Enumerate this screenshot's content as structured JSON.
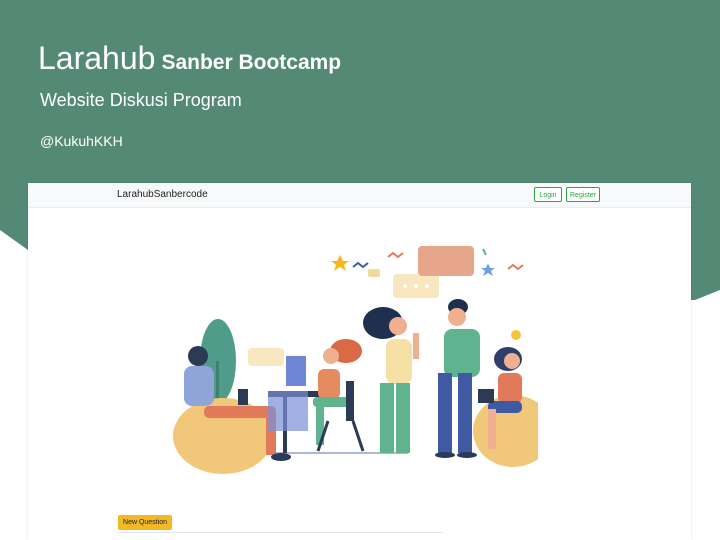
{
  "slide": {
    "title_main": "Larahub",
    "title_sub": "Sanber Bootcamp",
    "subtitle": "Website Diskusi Program",
    "author": "@KukuhKKH",
    "banner_color": "#548a75"
  },
  "app": {
    "brand": "LarahubSanbercode",
    "login_label": "Login",
    "register_label": "Register",
    "new_question_label": "New Question",
    "accent_color": "#28a745",
    "button_color": "#f2b925"
  },
  "illustration": {
    "icon": "people-discussion-illustration"
  }
}
